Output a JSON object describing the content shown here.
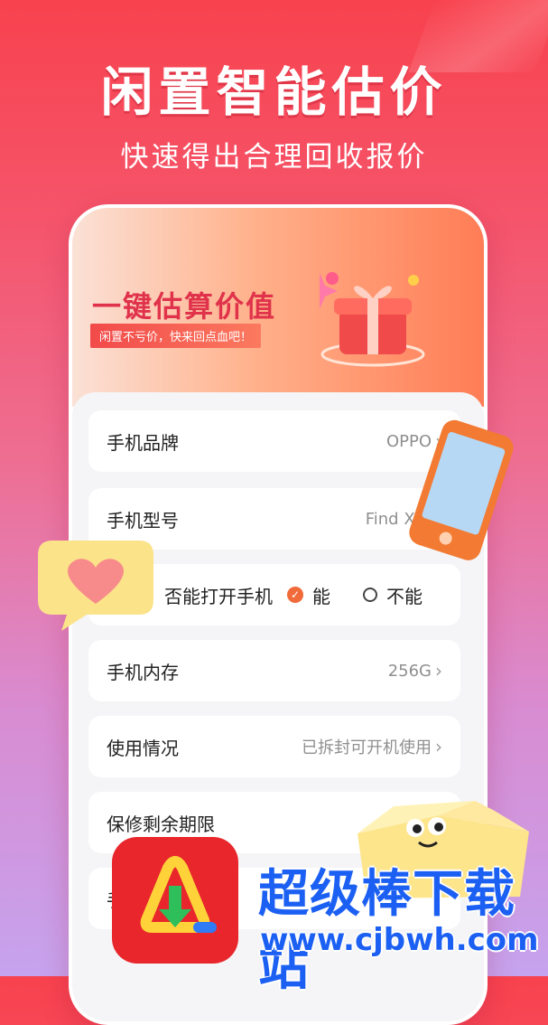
{
  "header": {
    "title": "闲置智能估价",
    "subtitle": "快速得出合理回收报价"
  },
  "banner": {
    "title": "一键估算价值",
    "tagline": "闲置不亏价，快来回点血吧！"
  },
  "form": {
    "brand": {
      "label": "手机品牌",
      "value": "OPPO"
    },
    "model": {
      "label": "手机型号",
      "value": "Find X7 U"
    },
    "power_on": {
      "label": "否能打开手机",
      "option_yes": "能",
      "option_no": "不能",
      "selected": "能"
    },
    "storage": {
      "label": "手机内存",
      "value": "256G"
    },
    "usage": {
      "label": "使用情况",
      "value": "已拆封可开机使用"
    },
    "warranty": {
      "label": "保修剩余期限",
      "value": "一"
    },
    "extra": {
      "label": "手"
    }
  },
  "watermark": {
    "name": "超级棒下载站",
    "url": "www.cjbwh.com"
  },
  "colors": {
    "accent": "#f06a3a",
    "brand_red": "#e0334b",
    "watermark_blue": "#1c60f3"
  }
}
